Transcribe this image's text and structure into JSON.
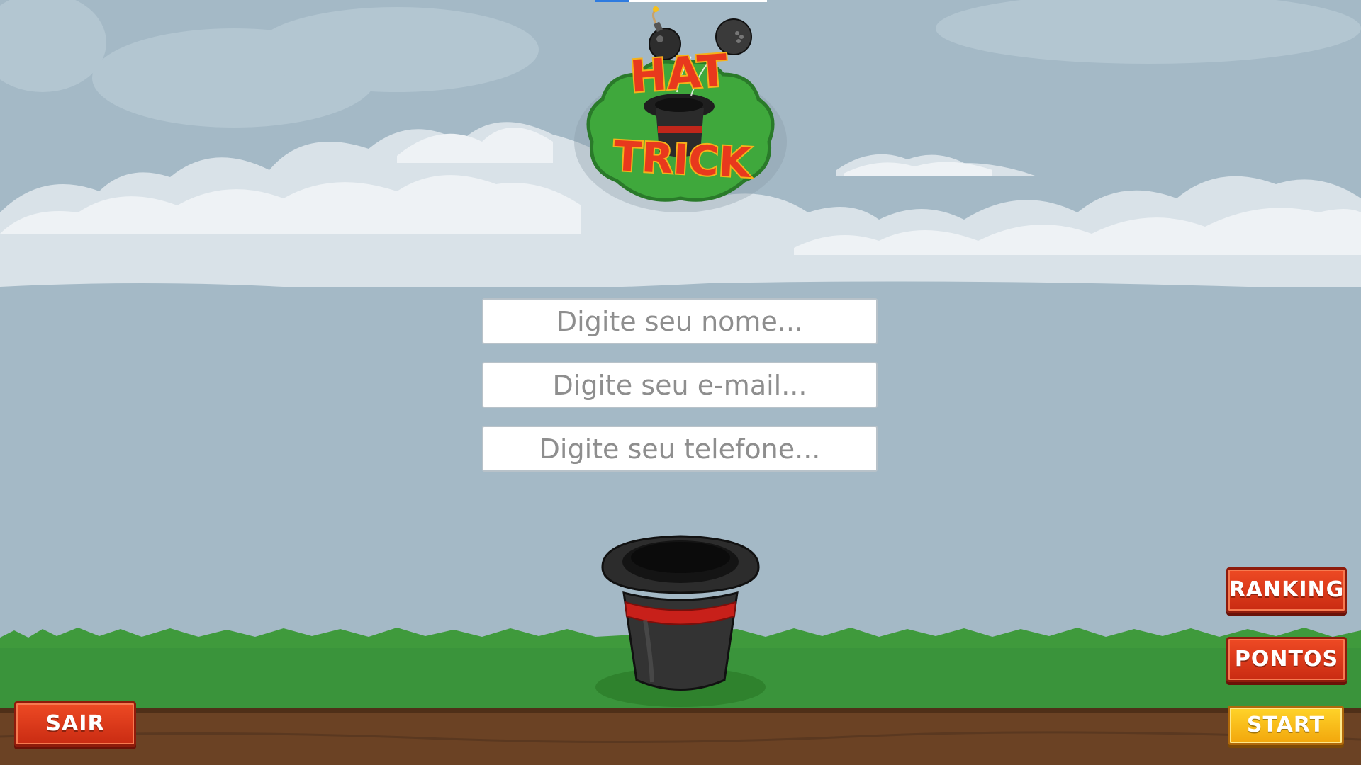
{
  "game": {
    "logo_text": [
      "HAT",
      "TRICK"
    ]
  },
  "form": {
    "name_placeholder": "Digite seu nome...",
    "email_placeholder": "Digite seu e-mail...",
    "phone_placeholder": "Digite seu telefone..."
  },
  "buttons": {
    "ranking": "RANKING",
    "pontos": "PONTOS",
    "start": "START",
    "sair": "SAIR"
  },
  "colors": {
    "sky": "#a4b9c6",
    "grass": "#3f9a3c",
    "dirt": "#6b4224",
    "button_red": "#e23c1b",
    "button_yellow": "#f7b81a"
  },
  "icons": [
    "top-hat-icon",
    "bomb-icon",
    "cloud-icon"
  ]
}
